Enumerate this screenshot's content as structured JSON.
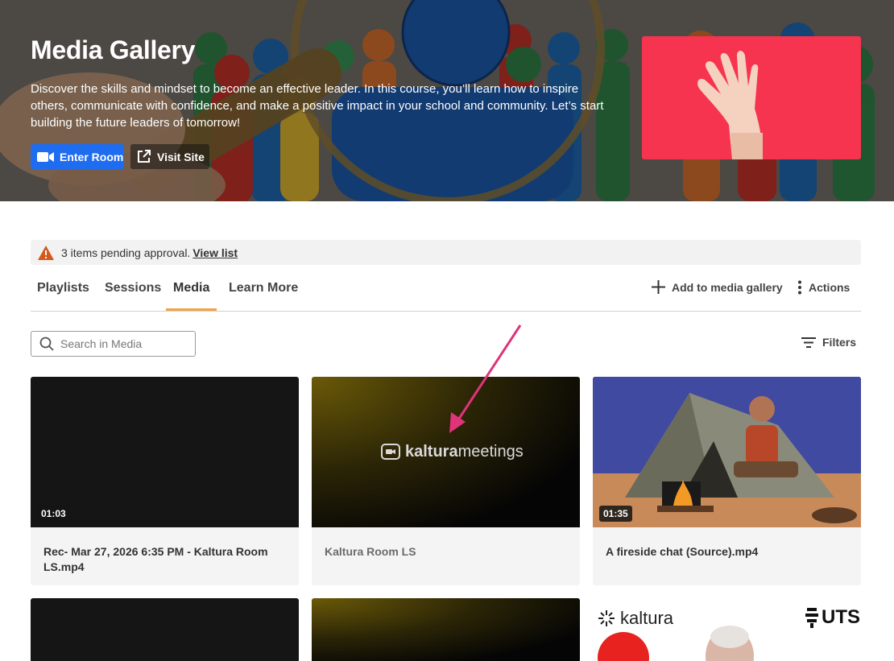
{
  "hero": {
    "title": "Media Gallery",
    "description": "Discover the skills and mindset to become an effective leader. In this course, you’ll learn how to inspire others, communicate with confidence, and make a positive impact in your school and community. Let’s start building the future leaders of tomorrow!",
    "enter_room_label": "Enter Room",
    "visit_site_label": "Visit Site"
  },
  "alert": {
    "text": "3 items pending approval.",
    "link": "View list",
    "icon": "warning-triangle-icon",
    "color": "#d35a1a"
  },
  "tabs": [
    {
      "label": "Playlists"
    },
    {
      "label": "Sessions"
    },
    {
      "label": "Media",
      "active": true
    },
    {
      "label": "Learn More"
    }
  ],
  "actions": {
    "add_label": "Add to media gallery",
    "actions_label": "Actions"
  },
  "search": {
    "placeholder": "Search in Media"
  },
  "filters_label": "Filters",
  "media": [
    {
      "title": "Rec- Mar 27, 2026 6:35 PM - Kaltura Room LS.mp4",
      "duration": "01:03"
    },
    {
      "title": "Kaltura Room LS",
      "logo_text_bold": "kaltura",
      "logo_text": "meetings"
    },
    {
      "title": "A fireside chat (Source).mp4",
      "duration": "01:35"
    }
  ],
  "second_row": {
    "brand": "kaltura",
    "partner": "UTS"
  },
  "colors": {
    "accent": "#1e6cf0",
    "tab_active": "#f0a34a",
    "annotation": "#e0337a",
    "hero_thumb": "#f7344f"
  }
}
